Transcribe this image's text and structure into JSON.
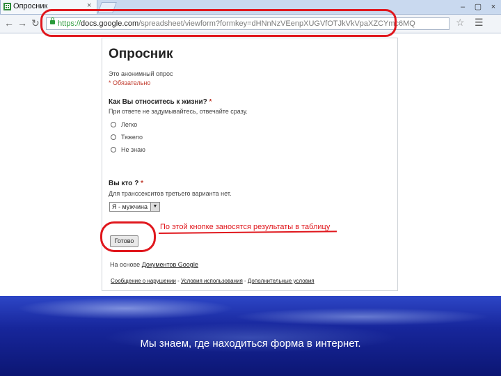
{
  "browser": {
    "tab_title": "Опросник",
    "tab_close": "×",
    "url_scheme": "https://",
    "url_host": "docs.google.com",
    "url_rest": "/spreadsheet/viewform?formkey=dHNnNzVEenpXUGVfOTJkVkVpaXZCYmc6MQ",
    "window_controls": [
      "–",
      "▢",
      "×"
    ]
  },
  "form": {
    "title": "Опросник",
    "subtitle": "Это анонимный опрос",
    "required_note": "* Обязательно",
    "q1": {
      "title": "Как Вы относитесь к жизни?",
      "required_mark": "*",
      "help": "При ответе не задумывайтесь, отвечайте сразу.",
      "options": [
        "Легко",
        "Тяжело",
        "Не знаю"
      ]
    },
    "q2": {
      "title": "Вы кто ?",
      "required_mark": "*",
      "help": "Для транссекситов третьего варианта нет.",
      "selected": "Я - мужчина"
    },
    "submit_label": "Готово",
    "powered_prefix": "На основе",
    "powered_link": "Документов Google",
    "footer": {
      "report": "Сообщение о нарушении",
      "sep1": " - ",
      "terms": "Условия использования",
      "sep2": " - ",
      "extra": "Дополнительные условия"
    }
  },
  "annotation": {
    "text": "По этой кнопке заносятся результаты в таблицу",
    "color": "#e0171d"
  },
  "slide": {
    "caption": "Мы знаем, где находиться форма в интернет."
  }
}
